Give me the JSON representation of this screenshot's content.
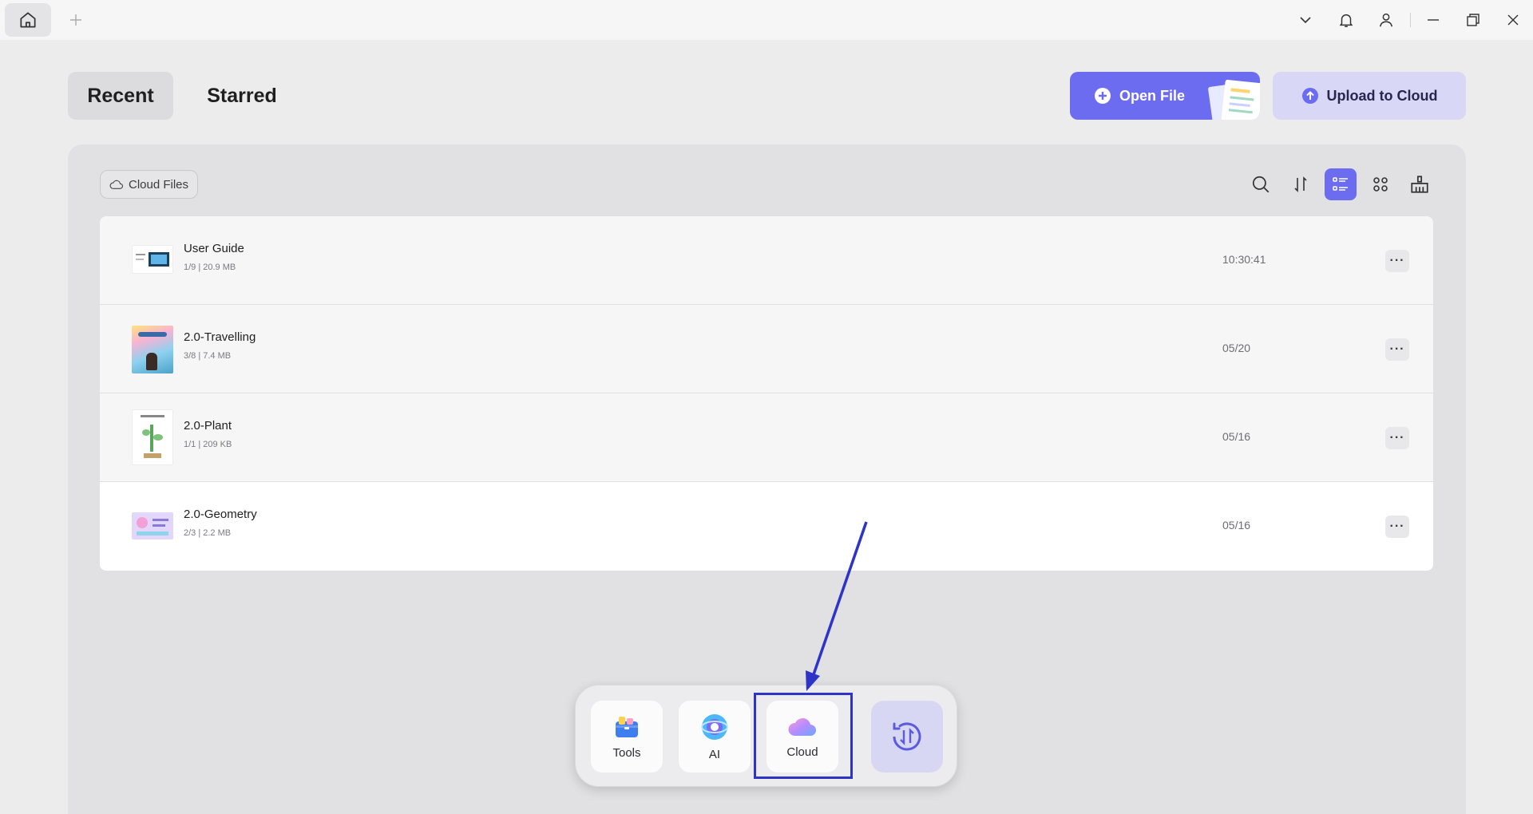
{
  "tabs": {
    "recent": "Recent",
    "starred": "Starred"
  },
  "actions": {
    "open_file": "Open File",
    "upload_cloud": "Upload to Cloud"
  },
  "filter": {
    "cloud_files": "Cloud Files"
  },
  "files": [
    {
      "name": "User Guide",
      "meta": "1/9 | 20.9 MB",
      "date": "10:30:41",
      "more": "···"
    },
    {
      "name": "2.0-Travelling",
      "meta": "3/8 | 7.4 MB",
      "date": "05/20",
      "more": "···"
    },
    {
      "name": "2.0-Plant",
      "meta": "1/1 | 209 KB",
      "date": "05/16",
      "more": "···"
    },
    {
      "name": "2.0-Geometry",
      "meta": "2/3 | 2.2 MB",
      "date": "05/16",
      "more": "···"
    }
  ],
  "dock": {
    "tools": "Tools",
    "ai": "AI",
    "cloud": "Cloud"
  },
  "icons": {
    "titlebar": [
      "home-icon",
      "plus-icon",
      "chevron-down-icon",
      "bell-icon",
      "user-icon",
      "minimize-icon",
      "restore-icon",
      "close-icon"
    ],
    "toolbar": [
      "search-icon",
      "sort-icon",
      "list-view-icon",
      "grid-view-icon",
      "clean-icon"
    ]
  },
  "colors": {
    "accent": "#6c6cf0",
    "annotation": "#2f34c9",
    "upload_bg": "#d8d8f6"
  }
}
